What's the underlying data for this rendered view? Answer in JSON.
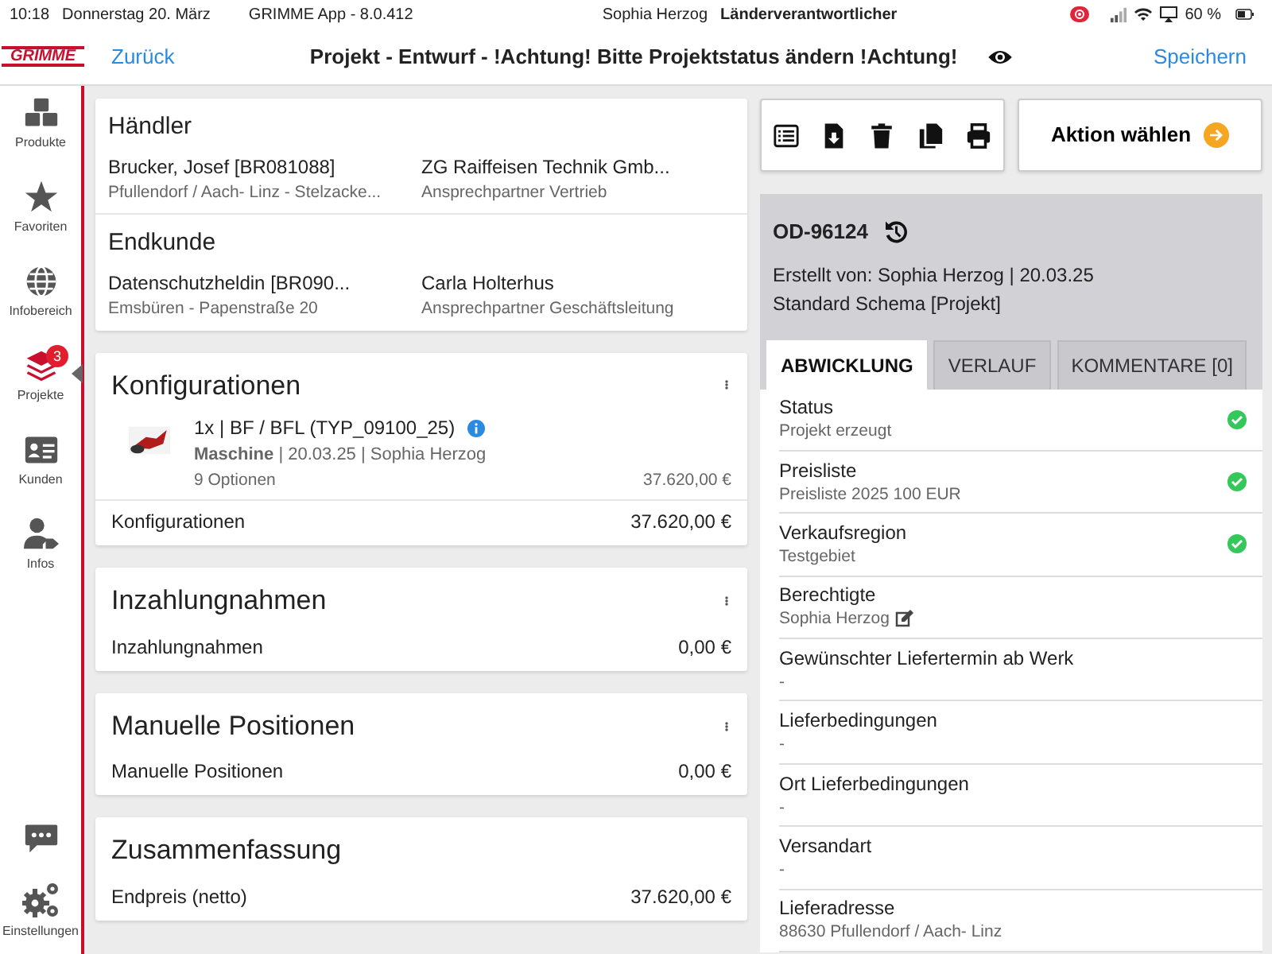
{
  "status_bar": {
    "time": "10:18",
    "date": "Donnerstag 20. März",
    "app": "GRIMME App - 8.0.412",
    "user": "Sophia Herzog",
    "role": "Länderverantwortlicher",
    "battery": "60 %"
  },
  "header": {
    "logo": "GRIMME",
    "back": "Zurück",
    "title": "Projekt - Entwurf - !Achtung! Bitte Projektstatus ändern !Achtung!",
    "save": "Speichern"
  },
  "sidebar": {
    "items": [
      {
        "label": "Produkte",
        "selected": false
      },
      {
        "label": "Favoriten",
        "selected": false
      },
      {
        "label": "Infobereich",
        "selected": false
      },
      {
        "label": "Projekte",
        "selected": true,
        "badge": "3"
      },
      {
        "label": "Kunden",
        "selected": false
      },
      {
        "label": "Infos",
        "selected": false
      }
    ],
    "bottom_items": [
      {
        "kind": "chat"
      },
      {
        "kind": "settings",
        "label": "Einstellungen"
      }
    ]
  },
  "parties": [
    {
      "title": "Händler",
      "entries": [
        {
          "name": "Brucker, Josef [BR081088]",
          "detail": "Pfullendorf / Aach- Linz - Stelzacke..."
        },
        {
          "name": "ZG Raiffeisen Technik Gmb...",
          "detail": "Ansprechpartner Vertrieb"
        }
      ]
    },
    {
      "title": "Endkunde",
      "entries": [
        {
          "name": "Datenschutzheldin [BR090...",
          "detail": "Emsbüren - Papenstraße 20"
        },
        {
          "name": "Carla Holterhus",
          "detail": "Ansprechpartner Geschäftsleitung"
        }
      ]
    }
  ],
  "sections": [
    {
      "title": "Konfigurationen",
      "menu": true,
      "items": [
        {
          "line": "1x | BF / BFL (TYP_09100_25)",
          "meta": "**Maschine** | 20.03.25 | Sophia Herzog",
          "options": "9 Optionen",
          "price": "37.620,00 €"
        }
      ],
      "total_label": "Konfigurationen",
      "total": "37.620,00 €"
    },
    {
      "title": "Inzahlungnahmen",
      "menu": true,
      "total_label": "Inzahlungnahmen",
      "total": "0,00 €"
    },
    {
      "title": "Manuelle Positionen",
      "menu": true,
      "total_label": "Manuelle Positionen",
      "total": "0,00 €"
    },
    {
      "title": "Zusammenfassung",
      "menu": false,
      "total_label": "Endpreis (netto)",
      "total": "37.620,00 €"
    }
  ],
  "action_button": "Aktion wählen",
  "project": {
    "id": "OD-96124",
    "created": "Erstellt von: Sophia Herzog | 20.03.25",
    "schema": "Standard Schema [Projekt]"
  },
  "tabs": [
    {
      "label": "ABWICKLUNG",
      "selected": true
    },
    {
      "label": "VERLAUF",
      "selected": false
    },
    {
      "label": "KOMMENTARE [0]",
      "selected": false
    }
  ],
  "fields": [
    {
      "label": "Status",
      "value": "Projekt erzeugt",
      "done": true,
      "editable": false
    },
    {
      "label": "Preisliste",
      "value": "Preisliste 2025 100 EUR",
      "done": true,
      "editable": false
    },
    {
      "label": "Verkaufsregion",
      "value": "Testgebiet",
      "done": true,
      "editable": false
    },
    {
      "label": "Berechtigte",
      "value": "Sophia Herzog",
      "done": false,
      "editable": true
    },
    {
      "label": "Gewünschter Liefertermin ab Werk",
      "value": "-",
      "done": false,
      "editable": false
    },
    {
      "label": "Lieferbedingungen",
      "value": "-",
      "done": false,
      "editable": false
    },
    {
      "label": "Ort Lieferbedingungen",
      "value": "-",
      "done": false,
      "editable": false
    },
    {
      "label": "Versandart",
      "value": "-",
      "done": false,
      "editable": false
    },
    {
      "label": "Lieferadresse",
      "value": "88630 Pfullendorf / Aach- Linz",
      "done": false,
      "editable": false
    }
  ]
}
